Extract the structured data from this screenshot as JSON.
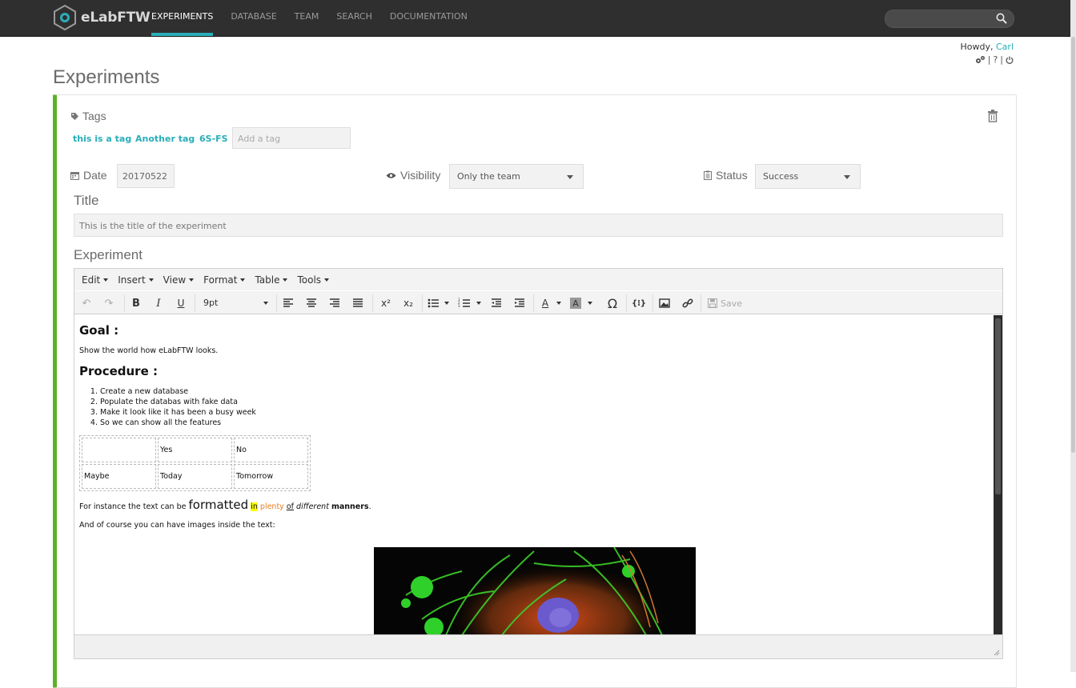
{
  "app": {
    "logo_text": "eLabFTW",
    "nav": [
      "EXPERIMENTS",
      "DATABASE",
      "TEAM",
      "SEARCH",
      "DOCUMENTATION"
    ],
    "active_nav": "EXPERIMENTS",
    "search_placeholder": ""
  },
  "user": {
    "greeting": "Howdy,",
    "name": "Carl",
    "icons": [
      "gears-icon",
      "help-icon",
      "power-icon"
    ],
    "separator": "|",
    "help_label": "?"
  },
  "page": {
    "title": "Experiments"
  },
  "tags": {
    "label": "Tags",
    "items": [
      "this is a tag",
      "Another tag",
      "6S-FS"
    ],
    "add_placeholder": "Add a tag"
  },
  "fields": {
    "date_label": "Date",
    "date_value": "20170522",
    "visibility_label": "Visibility",
    "visibility_value": "Only the team",
    "status_label": "Status",
    "status_value": "Success",
    "title_label": "Title",
    "title_value": "This is the title of the experiment",
    "experiment_label": "Experiment"
  },
  "editor": {
    "menus": [
      "Edit",
      "Insert",
      "View",
      "Format",
      "Table",
      "Tools"
    ],
    "font_size": "9pt",
    "save_label": "Save",
    "content": {
      "goal_heading": "Goal :",
      "goal_text": "Show the world how eLabFTW looks.",
      "procedure_heading": "Procedure :",
      "steps": [
        " Create a new database",
        "Populate the databas with fake data",
        "Make it look like it has been a busy week",
        "So we can show all the features"
      ],
      "table": [
        [
          "",
          "Yes",
          "No"
        ],
        [
          "Maybe",
          "Today",
          "Tomorrow"
        ]
      ],
      "formatted_prefix": "For instance the text can be ",
      "formatted_word": "formatted",
      "in_word": "in",
      "plenty_word": "plenty",
      "of_word": "of",
      "different_word": "different",
      "manners_word": "manners",
      "period": ".",
      "images_text": "And of course you can have images inside the text:"
    }
  },
  "colors": {
    "accent": "#29aeb9",
    "status_bar": "#5bb123",
    "highlight": "#ffff00",
    "orange": "#e67e22"
  }
}
